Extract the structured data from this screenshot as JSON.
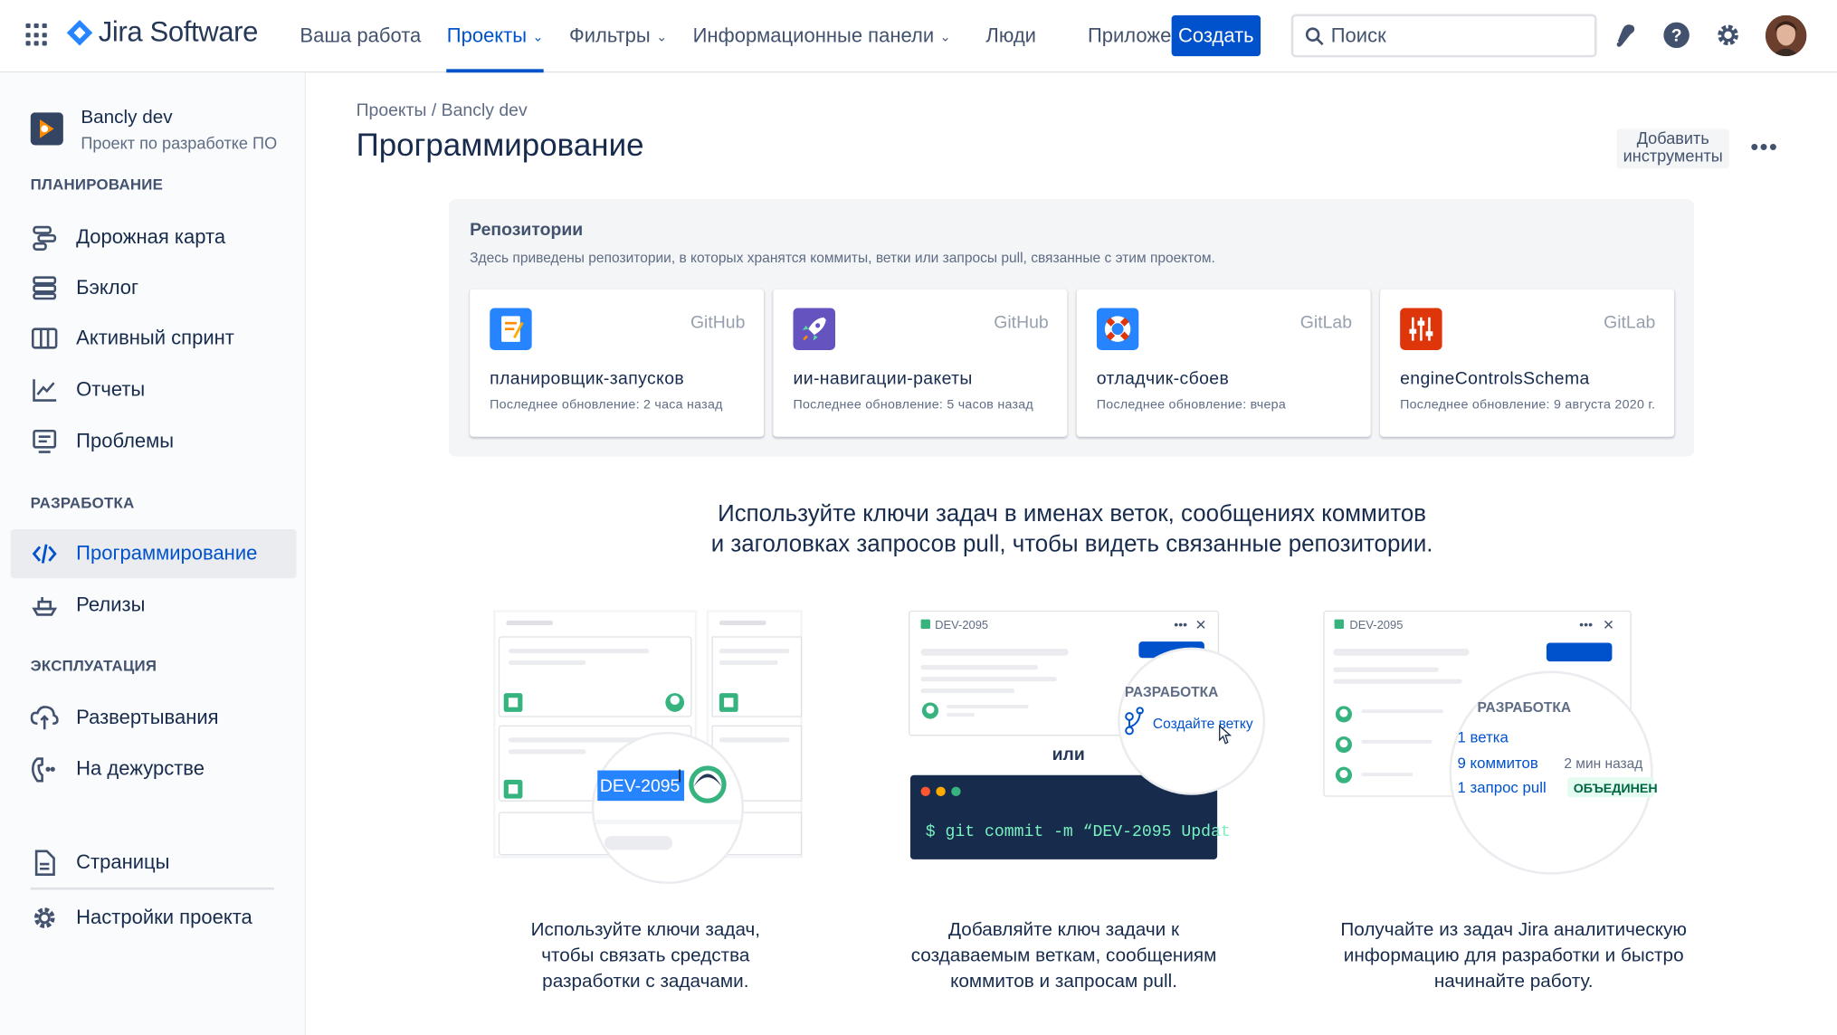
{
  "topnav": {
    "product": "Jira Software",
    "items": [
      {
        "label": "Ваша работа"
      },
      {
        "label": "Проекты"
      },
      {
        "label": "Фильтры"
      },
      {
        "label": "Информационные панели"
      },
      {
        "label": "Люди"
      },
      {
        "label": "Приложения"
      }
    ],
    "create_label": "Создать",
    "search_placeholder": "Поиск"
  },
  "sidebar": {
    "project_name": "Bancly dev",
    "project_type": "Проект по разработке ПО",
    "planning_heading": "ПЛАНИРОВАНИЕ",
    "planning": [
      "Дорожная карта",
      "Бэклог",
      "Активный спринт",
      "Отчеты",
      "Проблемы"
    ],
    "dev_heading": "РАЗРАБОТКА",
    "dev": [
      "Программирование",
      "Релизы"
    ],
    "ops_heading": "ЭКСПЛУАТАЦИЯ",
    "ops": [
      "Развертывания",
      "На дежурстве"
    ],
    "footer": [
      "Страницы",
      "Настройки проекта"
    ]
  },
  "main": {
    "breadcrumb": "Проекты / Bancly dev",
    "title": "Программирование",
    "add_tools": "Добавить инструменты",
    "more": "•••",
    "repos_title": "Репозитории",
    "repos_desc": "Здесь приведены репозитории, в которых хранятся коммиты, ветки или запросы pull, связанные с этим проектом.",
    "repos": [
      {
        "source": "GitHub",
        "name": "планировщик-запусков",
        "updated": "Последнее обновление: 2 часа назад",
        "color": "#2684ff"
      },
      {
        "source": "GitHub",
        "name": "ии-навигации-ракеты",
        "updated": "Последнее обновление: 5 часов назад",
        "color": "#6554c0"
      },
      {
        "source": "GitLab",
        "name": "отладчик-сбоев",
        "updated": "Последнее обновление: вчера",
        "color": "#2684ff"
      },
      {
        "source": "GitLab",
        "name": "engineControlsSchema",
        "updated": "Последнее обновление: 9 августа 2020 г.",
        "color": "#de350b"
      }
    ],
    "promo_line1": "Используйте ключи задач в именах веток, сообщениях коммитов",
    "promo_line2": "и заголовках запросов pull, чтобы видеть связанные репозитории.",
    "ill": {
      "key": "DEV-2095",
      "dev": "РАЗРАБОТКА",
      "create_branch": "Создайте ветку",
      "or": "или",
      "cmd": "$ git commit -m “DEV-2095 Updat",
      "branch": "1 ветка",
      "commits": "9 коммитов",
      "time": "2 мин назад",
      "pr": "1 запрос pull",
      "merged": "ОБЪЕДИНЕН"
    },
    "captions": [
      [
        "Используйте ключи задач,",
        "чтобы связать средства",
        "разработки с задачами."
      ],
      [
        "Добавляйте ключ задачи к",
        "создаваемым веткам, сообщениям",
        "коммитов и запросам pull."
      ],
      [
        "Получайте из задач Jira аналитическую",
        "информацию для разработки и быстро",
        "начинайте работу."
      ]
    ]
  }
}
